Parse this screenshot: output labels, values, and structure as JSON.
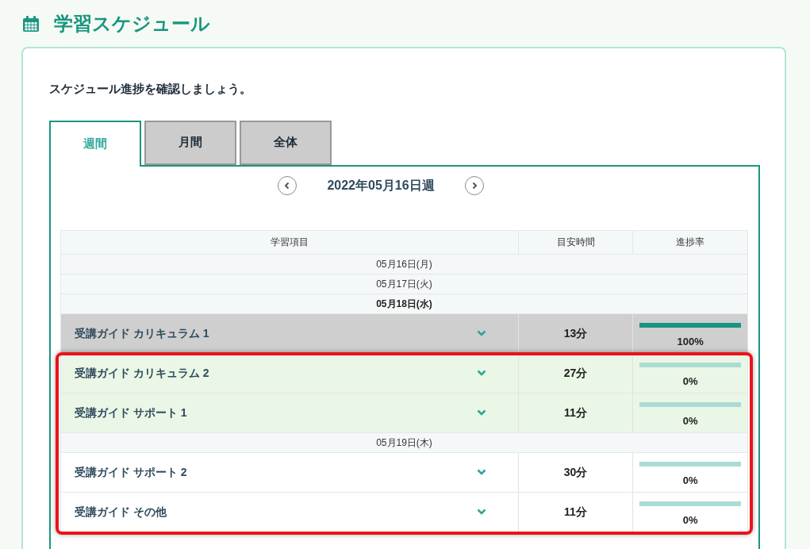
{
  "page": {
    "title": "学習スケジュール"
  },
  "intro": "スケジュール進捗を確認しましょう。",
  "tabs": [
    {
      "label": "週間",
      "selected": true
    },
    {
      "label": "月間",
      "selected": false
    },
    {
      "label": "全体",
      "selected": false
    }
  ],
  "week_nav": {
    "label": "2022年05月16日週"
  },
  "table": {
    "columns": [
      "学習項目",
      "目安時間",
      "進捗率"
    ],
    "rows": [
      {
        "kind": "date",
        "label": "05月16日(月)",
        "selected": false
      },
      {
        "kind": "date",
        "label": "05月17日(火)",
        "selected": false
      },
      {
        "kind": "date",
        "label": "05月18日(水)",
        "selected": true
      },
      {
        "kind": "item",
        "name": "受講ガイド カリキュラム 1",
        "time": "13分",
        "level": 1,
        "reading": "100%",
        "highlighted": false
      }
    ],
    "outlined_rows": [
      {
        "kind": "item",
        "name": "受講ガイド カリキュラム 2",
        "time": "27分",
        "level": 0,
        "reading": "0%",
        "highlighted": true
      },
      {
        "kind": "item",
        "name": "受講ガイド サポート 1",
        "time": "11分",
        "level": 0,
        "reading": "0%",
        "highlighted": true
      },
      {
        "kind": "date",
        "label": "05月19日(木)",
        "selected": false
      },
      {
        "kind": "item",
        "name": "受講ガイド サポート 2",
        "time": "30分",
        "level": 0,
        "reading": "0%",
        "highlighted": false
      },
      {
        "kind": "item",
        "name": "受講ガイド その他",
        "time": "11分",
        "level": 0,
        "reading": "0%",
        "highlighted": false
      }
    ]
  }
}
